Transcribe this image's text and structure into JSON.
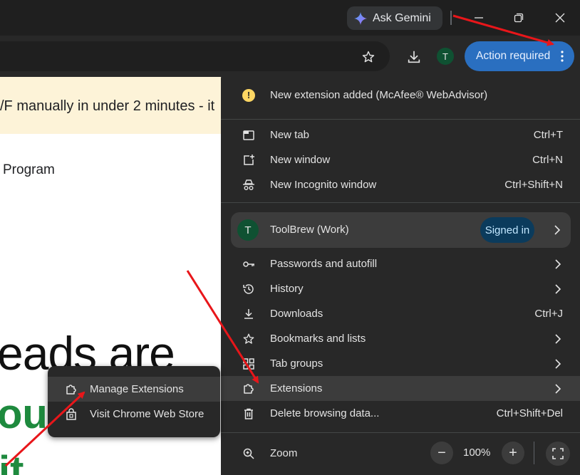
{
  "titlebar": {
    "gemini_label": "Ask Gemini"
  },
  "toolbar": {
    "profile_initial": "T",
    "action_label": "Action required"
  },
  "page": {
    "banner_text": "/F manually in under 2 minutes - it",
    "program_text": "Program",
    "big_text": "eads are",
    "green_text": "ou",
    "green_text2": "it"
  },
  "menu": {
    "notice": "New extension added (McAfee® WebAdvisor)",
    "new_tab": {
      "label": "New tab",
      "shortcut": "Ctrl+T"
    },
    "new_window": {
      "label": "New window",
      "shortcut": "Ctrl+N"
    },
    "incognito": {
      "label": "New Incognito window",
      "shortcut": "Ctrl+Shift+N"
    },
    "profile": {
      "initial": "T",
      "name": "ToolBrew (Work)",
      "status": "Signed in"
    },
    "passwords": {
      "label": "Passwords and autofill"
    },
    "history": {
      "label": "History"
    },
    "downloads": {
      "label": "Downloads",
      "shortcut": "Ctrl+J"
    },
    "bookmarks": {
      "label": "Bookmarks and lists"
    },
    "tab_groups": {
      "label": "Tab groups"
    },
    "extensions": {
      "label": "Extensions"
    },
    "delete_data": {
      "label": "Delete browsing data...",
      "shortcut": "Ctrl+Shift+Del"
    },
    "zoom": {
      "label": "Zoom",
      "value": "100%",
      "minus": "−",
      "plus": "+"
    }
  },
  "submenu": {
    "manage": "Manage Extensions",
    "store": "Visit Chrome Web Store"
  },
  "colors": {
    "accent": "#2a6fc0",
    "annotation": "#e8161a"
  }
}
